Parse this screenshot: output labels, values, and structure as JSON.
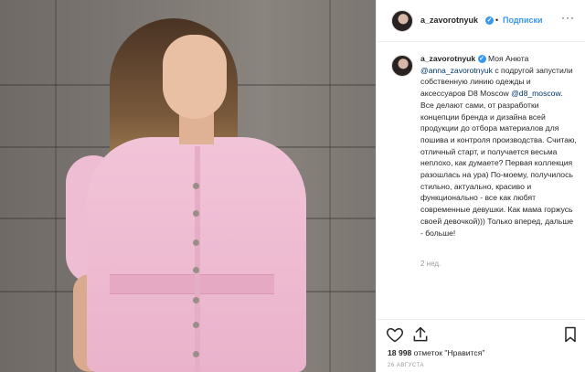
{
  "post": {
    "username": "a_zavorotnyuk",
    "verified_badge": "✓",
    "separator": "•",
    "follow_label": "Подписки",
    "more_label": "···",
    "caption": {
      "author": "a_zavorotnyuk",
      "text_1": " Моя Анюта ",
      "mention_1": "@anna_zavorotnyuk",
      "text_2": " с подругой запустили собственную линию одежды и аксессуаров D8 Moscow ",
      "mention_2": "@d8_moscow",
      "text_3": ". Все делают сами, от разработки концепции бренда и дизайна всей продукции до отбора материалов для пошива и контроля производства. Считаю, отличный старт, и получается весьма неплохо, как думаете? Первая коллекция разошлась на ура) По-моему, получилось стильно, актуально, красиво и функционально - все как любят современные девушки. Как мама горжусь своей девочкой))) Только вперед, дальше - больше!"
    },
    "time_ago": "2 нед.",
    "likes_count": "18 998",
    "likes_text": " отметок \"Нравится\"",
    "date": "26 АВГУСТА"
  },
  "icons": {
    "like": "heart-icon",
    "share": "share-icon",
    "save": "bookmark-icon"
  },
  "colors": {
    "accent": "#3897f0",
    "mention": "#003569",
    "dress": "#f2c4d8"
  }
}
